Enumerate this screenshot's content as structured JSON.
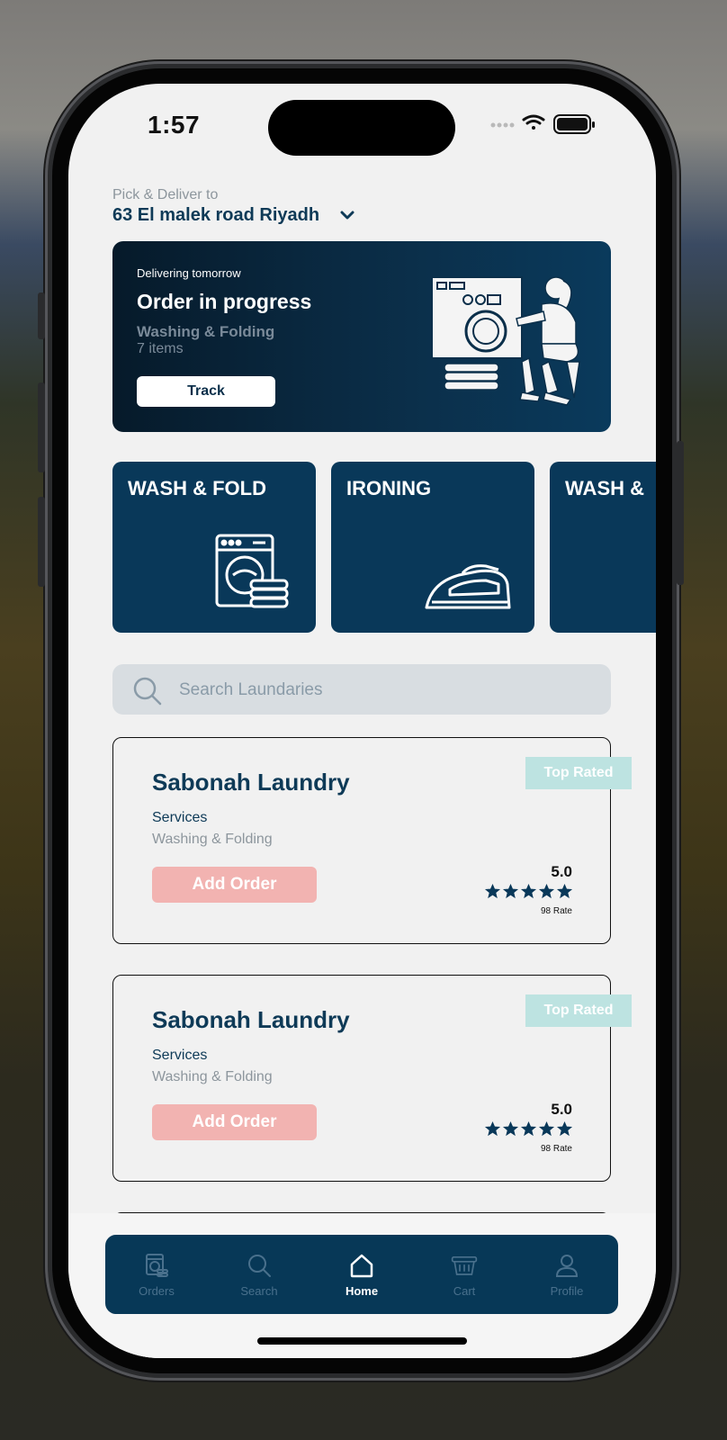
{
  "status_bar": {
    "time": "1:57"
  },
  "address": {
    "label": "Pick & Deliver to",
    "value": "63 El malek road Riyadh"
  },
  "order_banner": {
    "subtitle": "Delivering tomorrow",
    "title": "Order in progress",
    "service": "Washing & Folding",
    "items": "7 items",
    "track_label": "Track"
  },
  "categories": [
    {
      "label": "WASH & FOLD",
      "icon": "washing-machine-icon"
    },
    {
      "label": "IRONING",
      "icon": "iron-icon"
    },
    {
      "label": "WASH &",
      "icon": ""
    }
  ],
  "search": {
    "placeholder": "Search Laundaries"
  },
  "laundries": [
    {
      "name": "Sabonah Laundry",
      "services_label": "Services",
      "services": "Washing & Folding",
      "button": "Add Order",
      "badge": "Top Rated",
      "rating": "5.0",
      "stars": 5,
      "rate_count": "98 Rate"
    },
    {
      "name": "Sabonah Laundry",
      "services_label": "Services",
      "services": "Washing & Folding",
      "button": "Add Order",
      "badge": "Top Rated",
      "rating": "5.0",
      "stars": 5,
      "rate_count": "98 Rate"
    }
  ],
  "tab_bar": {
    "items": [
      {
        "label": "Orders",
        "icon": "orders-icon"
      },
      {
        "label": "Search",
        "icon": "search-icon"
      },
      {
        "label": "Home",
        "icon": "home-icon"
      },
      {
        "label": "Cart",
        "icon": "basket-icon"
      },
      {
        "label": "Profile",
        "icon": "profile-icon"
      }
    ],
    "active": "Home"
  },
  "colors": {
    "primary": "#093859",
    "accent_pink": "#f2b3b1",
    "badge_teal": "#bde3e1",
    "background": "#f1f1f1"
  }
}
